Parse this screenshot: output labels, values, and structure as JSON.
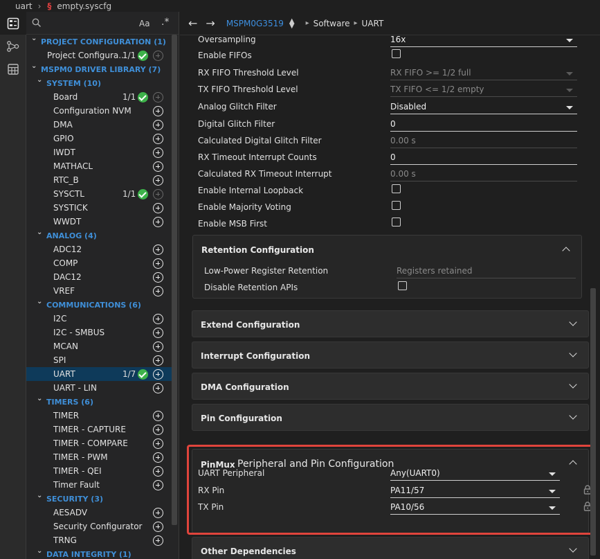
{
  "breadcrumb": {
    "project": "uart",
    "file": "empty.syscfg",
    "file_icon": "syscfg-file-icon"
  },
  "activity_bar": {
    "items": [
      "overview-icon",
      "diagram-icon",
      "table-icon"
    ]
  },
  "tree": {
    "search_icon": "search-icon",
    "match_case": "Aa",
    "regex": ".*",
    "rows": [
      {
        "kind": "cat",
        "level": 0,
        "label": "PROJECT CONFIGURATION (1)",
        "expanded": true
      },
      {
        "kind": "item",
        "level": 1,
        "label": "Project Configura...",
        "count": "1/1",
        "ok": true,
        "add_dim": true
      },
      {
        "kind": "cat",
        "level": 0,
        "label": "MSPM0 DRIVER LIBRARY (7)",
        "expanded": true
      },
      {
        "kind": "cat",
        "level": 1,
        "label": "SYSTEM (10)",
        "expanded": true
      },
      {
        "kind": "item",
        "level": 2,
        "label": "Board",
        "count": "1/1",
        "ok": true,
        "add_dim": true
      },
      {
        "kind": "item",
        "level": 2,
        "label": "Configuration NVM"
      },
      {
        "kind": "item",
        "level": 2,
        "label": "DMA"
      },
      {
        "kind": "item",
        "level": 2,
        "label": "GPIO"
      },
      {
        "kind": "item",
        "level": 2,
        "label": "IWDT"
      },
      {
        "kind": "item",
        "level": 2,
        "label": "MATHACL"
      },
      {
        "kind": "item",
        "level": 2,
        "label": "RTC_B"
      },
      {
        "kind": "item",
        "level": 2,
        "label": "SYSCTL",
        "count": "1/1",
        "ok": true,
        "add_dim": true
      },
      {
        "kind": "item",
        "level": 2,
        "label": "SYSTICK"
      },
      {
        "kind": "item",
        "level": 2,
        "label": "WWDT"
      },
      {
        "kind": "cat",
        "level": 1,
        "label": "ANALOG (4)",
        "expanded": true
      },
      {
        "kind": "item",
        "level": 2,
        "label": "ADC12"
      },
      {
        "kind": "item",
        "level": 2,
        "label": "COMP"
      },
      {
        "kind": "item",
        "level": 2,
        "label": "DAC12"
      },
      {
        "kind": "item",
        "level": 2,
        "label": "VREF"
      },
      {
        "kind": "cat",
        "level": 1,
        "label": "COMMUNICATIONS (6)",
        "expanded": true
      },
      {
        "kind": "item",
        "level": 2,
        "label": "I2C"
      },
      {
        "kind": "item",
        "level": 2,
        "label": "I2C - SMBUS"
      },
      {
        "kind": "item",
        "level": 2,
        "label": "MCAN"
      },
      {
        "kind": "item",
        "level": 2,
        "label": "SPI"
      },
      {
        "kind": "item",
        "level": 2,
        "label": "UART",
        "count": "1/7",
        "ok": true,
        "selected": true
      },
      {
        "kind": "item",
        "level": 2,
        "label": "UART - LIN"
      },
      {
        "kind": "cat",
        "level": 1,
        "label": "TIMERS (6)",
        "expanded": true
      },
      {
        "kind": "item",
        "level": 2,
        "label": "TIMER"
      },
      {
        "kind": "item",
        "level": 2,
        "label": "TIMER - CAPTURE"
      },
      {
        "kind": "item",
        "level": 2,
        "label": "TIMER - COMPARE"
      },
      {
        "kind": "item",
        "level": 2,
        "label": "TIMER - PWM"
      },
      {
        "kind": "item",
        "level": 2,
        "label": "TIMER - QEI"
      },
      {
        "kind": "item",
        "level": 2,
        "label": "Timer Fault"
      },
      {
        "kind": "cat",
        "level": 1,
        "label": "SECURITY (3)",
        "expanded": true
      },
      {
        "kind": "item",
        "level": 2,
        "label": "AESADV"
      },
      {
        "kind": "item",
        "level": 2,
        "label": "Security Configurator"
      },
      {
        "kind": "item",
        "level": 2,
        "label": "TRNG"
      },
      {
        "kind": "cat",
        "level": 1,
        "label": "DATA INTEGRITY (1)",
        "expanded": true
      }
    ]
  },
  "topbar": {
    "back": "←",
    "forward": "→",
    "device": "MSPM0G3519",
    "crumbs": [
      "Software",
      "UART"
    ]
  },
  "properties": [
    {
      "label": "Oversampling",
      "value": "16x",
      "type": "select"
    },
    {
      "label": "Enable FIFOs",
      "type": "checkbox",
      "checked": false
    },
    {
      "label": "RX FIFO Threshold Level",
      "value": "RX FIFO >= 1/2 full",
      "type": "select",
      "readonly": true
    },
    {
      "label": "TX FIFO Threshold Level",
      "value": "TX FIFO <= 1/2 empty",
      "type": "select",
      "readonly": true
    },
    {
      "label": "Analog Glitch Filter",
      "value": "Disabled",
      "type": "select"
    },
    {
      "label": "Digital Glitch Filter",
      "value": "0",
      "type": "input"
    },
    {
      "label": "Calculated Digital Glitch Filter",
      "value": "0.00 s",
      "type": "input",
      "readonly": true
    },
    {
      "label": "RX Timeout Interrupt Counts",
      "value": "0",
      "type": "input"
    },
    {
      "label": "Calculated RX Timeout Interrupt",
      "value": "0.00 s",
      "type": "input",
      "readonly": true
    },
    {
      "label": "Enable Internal Loopback",
      "type": "checkbox",
      "checked": false
    },
    {
      "label": "Enable Majority Voting",
      "type": "checkbox",
      "checked": false
    },
    {
      "label": "Enable MSB First",
      "type": "checkbox",
      "checked": false
    }
  ],
  "retention": {
    "title": "Retention Configuration",
    "rows": [
      {
        "label": "Low-Power Register Retention",
        "value": "Registers retained",
        "type": "input",
        "readonly": true
      },
      {
        "label": "Disable Retention APIs",
        "type": "checkbox",
        "checked": false
      }
    ]
  },
  "sections": [
    {
      "title": "Extend Configuration"
    },
    {
      "title": "Interrupt Configuration"
    },
    {
      "title": "DMA Configuration"
    },
    {
      "title": "Pin Configuration"
    }
  ],
  "pinmux": {
    "tag": "PinMux",
    "title": "Peripheral and Pin Configuration",
    "rows": [
      {
        "label": "UART Peripheral",
        "value": "Any(UART0)",
        "locked": false
      },
      {
        "label": "RX Pin",
        "value": "PA11/57",
        "locked": true
      },
      {
        "label": "TX Pin",
        "value": "PA10/56",
        "locked": true
      }
    ]
  },
  "other": {
    "title": "Other Dependencies"
  },
  "colors": {
    "accent": "#3d8fe0",
    "ok": "#3db24a",
    "highlight": "#e0443c",
    "selected_row": "#0e3a5a"
  }
}
